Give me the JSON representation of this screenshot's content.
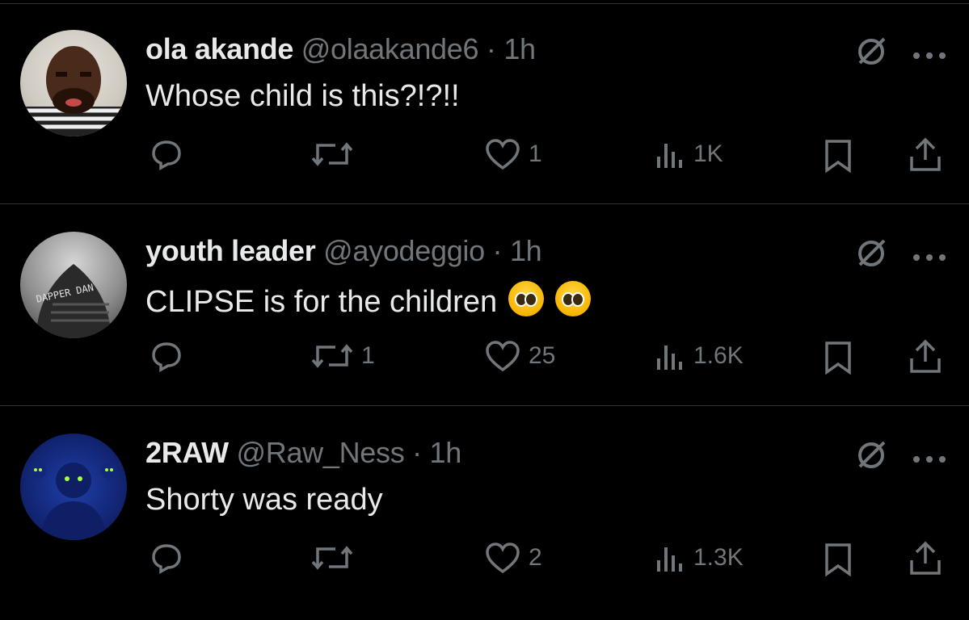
{
  "tweets": [
    {
      "name": "ola akande",
      "handle": "@olaakande6",
      "time": "1h",
      "text": "Whose child is this?!?!!",
      "replies": "",
      "retweets": "",
      "likes": "1",
      "views": "1K",
      "emojis": []
    },
    {
      "name": "youth leader",
      "handle": "@ayodeggio",
      "time": "1h",
      "text": "CLIPSE is for the children",
      "replies": "",
      "retweets": "1",
      "likes": "25",
      "views": "1.6K",
      "emojis": [
        "pleading-face",
        "pleading-face"
      ],
      "avatar_text": "DAPPER DAN"
    },
    {
      "name": "2RAW",
      "handle": "@Raw_Ness",
      "time": "1h",
      "text": "Shorty was ready",
      "replies": "",
      "retweets": "",
      "likes": "2",
      "views": "1.3K",
      "emojis": []
    }
  ],
  "colors": {
    "background": "#000000",
    "text": "#e7e9ea",
    "muted": "#71767b",
    "divider": "#2f3336"
  }
}
